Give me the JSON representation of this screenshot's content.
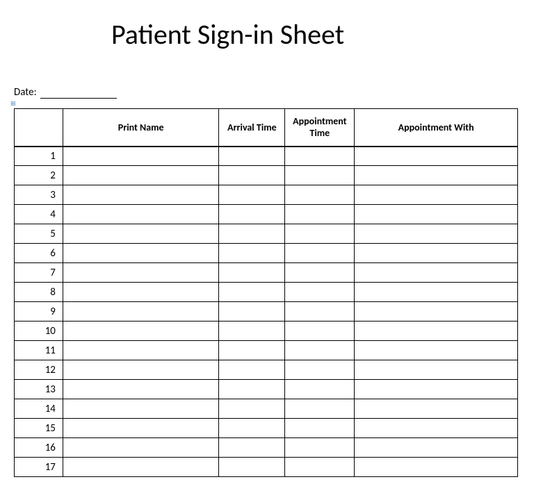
{
  "title": "Patient Sign-in Sheet",
  "date_label": "Date:",
  "date_value": "",
  "columns": {
    "num": "",
    "name": "Print Name",
    "arrival": "Arrival Time",
    "appt_time": "Appointment Time",
    "appt_with": "Appointment With"
  },
  "rows": [
    {
      "num": "1",
      "name": "",
      "arrival": "",
      "appt_time": "",
      "appt_with": ""
    },
    {
      "num": "2",
      "name": "",
      "arrival": "",
      "appt_time": "",
      "appt_with": ""
    },
    {
      "num": "3",
      "name": "",
      "arrival": "",
      "appt_time": "",
      "appt_with": ""
    },
    {
      "num": "4",
      "name": "",
      "arrival": "",
      "appt_time": "",
      "appt_with": ""
    },
    {
      "num": "5",
      "name": "",
      "arrival": "",
      "appt_time": "",
      "appt_with": ""
    },
    {
      "num": "6",
      "name": "",
      "arrival": "",
      "appt_time": "",
      "appt_with": ""
    },
    {
      "num": "7",
      "name": "",
      "arrival": "",
      "appt_time": "",
      "appt_with": ""
    },
    {
      "num": "8",
      "name": "",
      "arrival": "",
      "appt_time": "",
      "appt_with": ""
    },
    {
      "num": "9",
      "name": "",
      "arrival": "",
      "appt_time": "",
      "appt_with": ""
    },
    {
      "num": "10",
      "name": "",
      "arrival": "",
      "appt_time": "",
      "appt_with": ""
    },
    {
      "num": "11",
      "name": "",
      "arrival": "",
      "appt_time": "",
      "appt_with": ""
    },
    {
      "num": "12",
      "name": "",
      "arrival": "",
      "appt_time": "",
      "appt_with": ""
    },
    {
      "num": "13",
      "name": "",
      "arrival": "",
      "appt_time": "",
      "appt_with": ""
    },
    {
      "num": "14",
      "name": "",
      "arrival": "",
      "appt_time": "",
      "appt_with": ""
    },
    {
      "num": "15",
      "name": "",
      "arrival": "",
      "appt_time": "",
      "appt_with": ""
    },
    {
      "num": "16",
      "name": "",
      "arrival": "",
      "appt_time": "",
      "appt_with": ""
    },
    {
      "num": "17",
      "name": "",
      "arrival": "",
      "appt_time": "",
      "appt_with": ""
    }
  ]
}
